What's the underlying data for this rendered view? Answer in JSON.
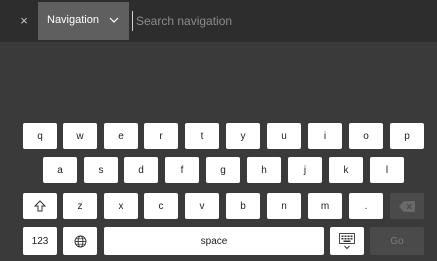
{
  "header": {
    "close_icon": "×",
    "dropdown": {
      "selected": "Navigation"
    },
    "search": {
      "placeholder": "Search navigation",
      "value": ""
    }
  },
  "keyboard": {
    "row1": [
      "q",
      "w",
      "e",
      "r",
      "t",
      "y",
      "u",
      "i",
      "o",
      "p"
    ],
    "row2": [
      "a",
      "s",
      "d",
      "f",
      "g",
      "h",
      "j",
      "k",
      "l"
    ],
    "row3": [
      "z",
      "x",
      "c",
      "v",
      "b",
      "n",
      "m",
      "."
    ],
    "shift_icon": "shift-arrow-icon",
    "backspace_icon": "backspace-icon",
    "numbers_label": "123",
    "globe_icon": "globe-icon",
    "space_label": "space",
    "keyboard_icon": "keyboard-hide-icon",
    "go_label": "Go"
  },
  "colors": {
    "background": "#3a3a3a",
    "topbar": "#2d2d2d",
    "dropdown": "#5f5f5f",
    "key": "#ffffff",
    "key_disabled": "#4a4a4a"
  }
}
